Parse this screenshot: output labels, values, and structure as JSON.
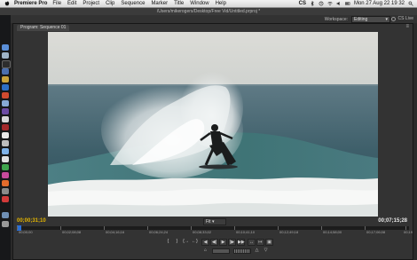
{
  "menubar": {
    "app_name": "Premiere Pro",
    "items": [
      "File",
      "Edit",
      "Project",
      "Clip",
      "Sequence",
      "Marker",
      "Title",
      "Window",
      "Help"
    ],
    "cs_badge": "CS",
    "datetime": "Mon 27 Aug  22 19 32"
  },
  "titlebar": {
    "text": "/Users/mikerogers/Desktop/Free Vid/Untitled.prproj *"
  },
  "workspace": {
    "label": "Workspace:",
    "selected": "Editing",
    "cs_live": "CS Live"
  },
  "program_panel": {
    "tab_label": "Program: Sequence 01",
    "menu_icon": "panel-menu-icon",
    "timecode_current": "00;00;31;10",
    "timecode_duration": "00;07;15;28",
    "fit_label": "Fit"
  },
  "ruler": {
    "labels": [
      "00;00;00",
      "00;02;08;08",
      "00;04;16;16",
      "00;06;24;24",
      "00;08;33;02",
      "00;10;41;10",
      "00;12;49;18",
      "00;14;58;00",
      "00;17;06;08",
      "00;19"
    ]
  },
  "transport": {
    "buttons": [
      "{",
      "}",
      "{→",
      "←}",
      "◀",
      "◀|",
      "▶",
      "|▶",
      "▶▶",
      "↔",
      "↦",
      "▣",
      "⌂",
      "△",
      "▽"
    ]
  },
  "colors": {
    "timecode_accent": "#e2b400",
    "playhead": "#2b6fd6"
  }
}
